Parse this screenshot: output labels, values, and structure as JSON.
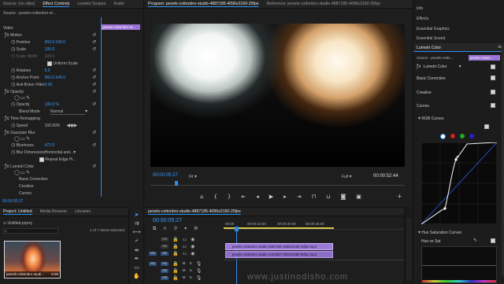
{
  "top_left_tabs": [
    "Source: (no clips)",
    "Effect Controls",
    "Lumetri Scopes",
    "Audio"
  ],
  "effect_controls": {
    "source_line": "Source - pexels-cottonbro-st...",
    "clip_line": "pexels-cottonbro-st...",
    "video_label": "Video",
    "items": [
      {
        "label": "Motion",
        "value": ""
      },
      {
        "label": "Position",
        "value": "960.0    540.0"
      },
      {
        "label": "Scale",
        "value": "100.0"
      },
      {
        "label": "Scale Width",
        "value": "100.0"
      },
      {
        "label": "Uniform Scale",
        "value": ""
      },
      {
        "label": "Rotation",
        "value": "0.0"
      },
      {
        "label": "Anchor Point",
        "value": "960.0    540.0"
      },
      {
        "label": "Anti-flicker Filter",
        "value": "0.00"
      },
      {
        "label": "Opacity",
        "value": ""
      },
      {
        "label": "Opacity",
        "value": "100.0 %"
      },
      {
        "label": "Blend Mode",
        "value": "Normal"
      },
      {
        "label": "Time Remapping",
        "value": ""
      },
      {
        "label": "Speed",
        "value": "100.00%"
      },
      {
        "label": "Gaussian Blur",
        "value": ""
      },
      {
        "label": "Blurriness",
        "value": "472.0"
      },
      {
        "label": "Blur Dimensions",
        "value": "Horizontal and..."
      },
      {
        "label": "Repeat Edge Pi...",
        "value": ""
      },
      {
        "label": "Lumetri Color",
        "value": ""
      },
      {
        "label": "Basic Correction",
        "value": ""
      },
      {
        "label": "Creative",
        "value": ""
      },
      {
        "label": "Curves",
        "value": ""
      }
    ],
    "timecode": "00:00:05:27"
  },
  "program_tabs": [
    "Program: pexels-cottonbro-studio-4887185-4096x2160-25fps",
    "Reference: pexels-cottonbro-studio-4887185-4096x2160-25fps"
  ],
  "program": {
    "timecode": "00:00:05:27",
    "fit": "Fit",
    "quality": "Full",
    "duration": "00:00:52:44"
  },
  "project": {
    "tabs": [
      "Project: Untitled",
      "Media Browser",
      "Libraries"
    ],
    "file": "Untitled.prproj",
    "selected": "1 of 7 items selected",
    "clip_name": "pexels-cottonbro-studi...",
    "clip_duration": "5:00"
  },
  "timeline": {
    "tab": "pexels-cottonbro-studio-4887185-4096x2160-25fps",
    "timecode": "00:00:05:27",
    "ruler": [
      "00:00",
      "00:00:15:00",
      "00:00:30:00",
      "00:00:45:00"
    ],
    "clip_v2": "pexels-cottonbro-studio-4887185-4096x2160-25fps.mp4",
    "clip_v1": "pexels-cottonbro-studio-4441587-2026x1080-50fps.mp4",
    "tracks_v": [
      "V3",
      "V2",
      "V1"
    ],
    "tracks_a": [
      "A1",
      "A2",
      "A3"
    ],
    "watermark": "www.justinodisho.com"
  },
  "right_panel": {
    "menu": [
      "Info",
      "Effects",
      "Essential Graphics",
      "Essential Sound",
      "Lumetri Color"
    ],
    "source": "Source - pexels-cotto...",
    "clip": "pexels-cotton...",
    "effect": "Lumetri Color",
    "sections": [
      "Basic Correction",
      "Creative",
      "Curves"
    ],
    "rgb_curves": "RGB Curves",
    "hue_sat": "Hue Saturation Curves",
    "hue_vs_sat": "Hue vs Sat"
  }
}
